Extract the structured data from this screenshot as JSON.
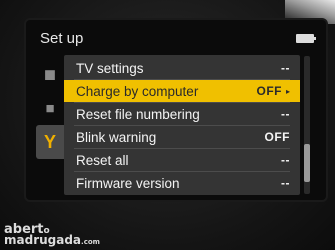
{
  "header": {
    "title": "Set up",
    "battery_icon": "battery-icon"
  },
  "tabs": [
    {
      "icon": "camera-icon",
      "glyph": "◼"
    },
    {
      "icon": "movie-camera-icon",
      "glyph": "■"
    },
    {
      "icon": "wrench-icon",
      "glyph": "Y"
    }
  ],
  "menu": {
    "items": [
      {
        "label": "TV settings",
        "value": "--"
      },
      {
        "label": "Charge by computer",
        "value": "OFF",
        "selected": true,
        "arrow": "▸"
      },
      {
        "label": "Reset file numbering",
        "value": "--"
      },
      {
        "label": "Blink warning",
        "value": "OFF"
      },
      {
        "label": "Reset all",
        "value": "--"
      },
      {
        "label": "Firmware version",
        "value": "--"
      }
    ],
    "selected_color": "#f0c000"
  },
  "watermark": {
    "line1": "abert",
    "line1_suffix": "o",
    "line2": "madrugada",
    "line2_suffix": ".com"
  }
}
